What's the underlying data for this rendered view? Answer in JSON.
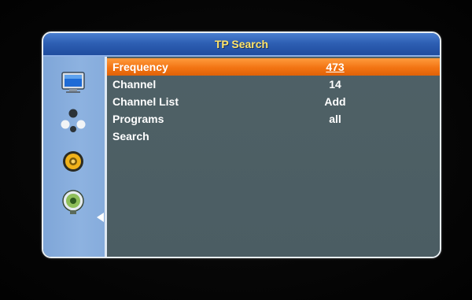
{
  "window": {
    "title": "TP Search"
  },
  "sidebar": {
    "icons": [
      {
        "name": "tv-icon"
      },
      {
        "name": "satellite-dish-icon"
      },
      {
        "name": "settings-gear-icon"
      },
      {
        "name": "satellite-search-icon"
      }
    ]
  },
  "menu": {
    "items": [
      {
        "label": "Frequency",
        "value": "473",
        "selected": true
      },
      {
        "label": "Channel",
        "value": "14"
      },
      {
        "label": "Channel List",
        "value": "Add"
      },
      {
        "label": "Programs",
        "value": "all"
      },
      {
        "label": "Search",
        "value": ""
      }
    ]
  },
  "colors": {
    "title_text": "#ffe56a",
    "title_bar": "#2e5fb3",
    "highlight": "#f27413",
    "panel": "#4a5c62",
    "sidebar": "#8db2e0"
  }
}
